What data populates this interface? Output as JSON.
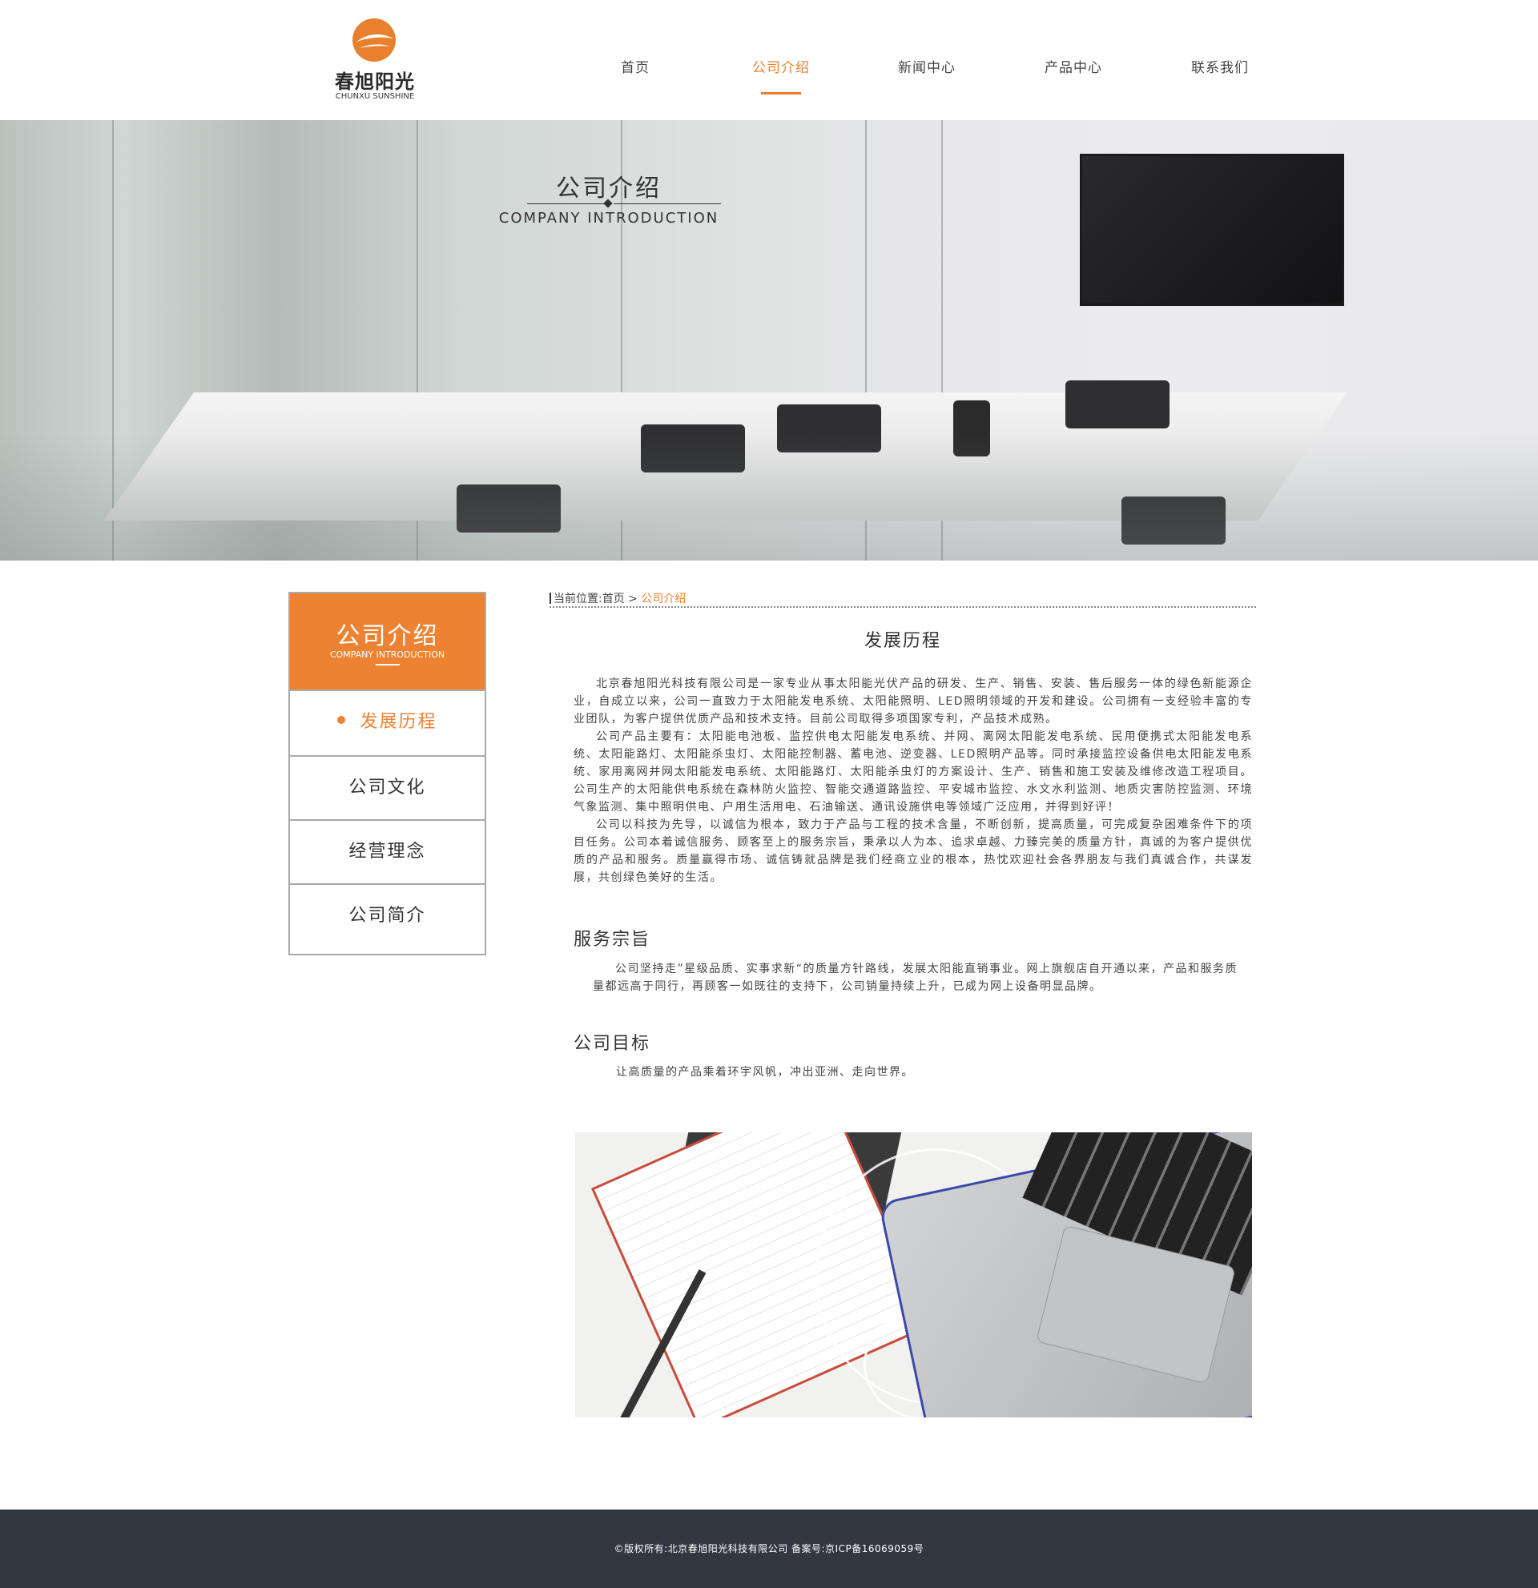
{
  "brand": {
    "name_cn": "春旭阳光",
    "name_en": "CHUNXU SUNSHINE",
    "accent_color": "#e8802e",
    "footer_color": "#323742"
  },
  "nav": {
    "items": [
      {
        "label": "首页"
      },
      {
        "label": "公司介绍",
        "active": true
      },
      {
        "label": "新闻中心"
      },
      {
        "label": "产品中心"
      },
      {
        "label": "联系我们"
      }
    ]
  },
  "banner": {
    "title_cn": "公司介绍",
    "title_en": "COMPANY INTRODUCTION"
  },
  "sidebar": {
    "head_cn": "公司介绍",
    "head_en": "COMPANY INTRODUCTION",
    "items": [
      {
        "label": "发展历程",
        "active": true
      },
      {
        "label": "公司文化"
      },
      {
        "label": "经营理念"
      },
      {
        "label": "公司简介"
      }
    ]
  },
  "breadcrumb": {
    "prefix": "当前位置:",
    "home": "首页",
    "separator": " > ",
    "current": "公司介绍"
  },
  "content": {
    "heading": "发展历程",
    "paragraphs": [
      "北京春旭阳光科技有限公司是一家专业从事太阳能光伏产品的研发、生产、销售、安装、售后服务一体的绿色新能源企业，自成立以来，公司一直致力于太阳能发电系统、太阳能照明、LED照明领域的开发和建设。公司拥有一支经验丰富的专业团队，为客户提供优质产品和技术支持。目前公司取得多项国家专利，产品技术成熟。",
      "公司产品主要有：太阳能电池板、监控供电太阳能发电系统、并网、离网太阳能发电系统、民用便携式太阳能发电系统、太阳能路灯、太阳能杀虫灯、太阳能控制器、蓄电池、逆变器、LED照明产品等。同时承接监控设备供电太阳能发电系统、家用离网并网太阳能发电系统、太阳能路灯、太阳能杀虫灯的方案设计、生产、销售和施工安装及维修改造工程项目。公司生产的太阳能供电系统在森林防火监控、智能交通道路监控、平安城市监控、水文水利监测、地质灾害防控监测、环境气象监测、集中照明供电、户用生活用电、石油输送、通讯设施供电等领域广泛应用，并得到好评！",
      "公司以科技为先导，以诚信为根本，致力于产品与工程的技术含量，不断创新，提高质量，可完成复杂困难条件下的项目任务。公司本着诚信服务、顾客至上的服务宗旨，秉承以人为本、追求卓越、力臻完美的质量方针，真诚的为客户提供优质的产品和服务。质量赢得市场、诚信铸就品牌是我们经商立业的根本，热忱欢迎社会各界朋友与我们真诚合作，共谋发展，共创绿色美好的生活。"
    ],
    "service_heading": "服务宗旨",
    "service_text": "公司坚持走”星级品质、实事求新“的质量方针路线，发展太阳能直销事业。网上旗舰店自开通以来，产品和服务质量都远高于同行，再顾客一如既往的支持下，公司销量持续上升，已成为网上设备明显品牌。",
    "goal_heading": "公司目标",
    "goal_text": "让高质量的产品乘着环宇风帆，冲出亚洲、走向世界。"
  },
  "footer": {
    "text": "©版权所有:北京春旭阳光科技有限公司    备案号:京ICP备16069059号"
  }
}
